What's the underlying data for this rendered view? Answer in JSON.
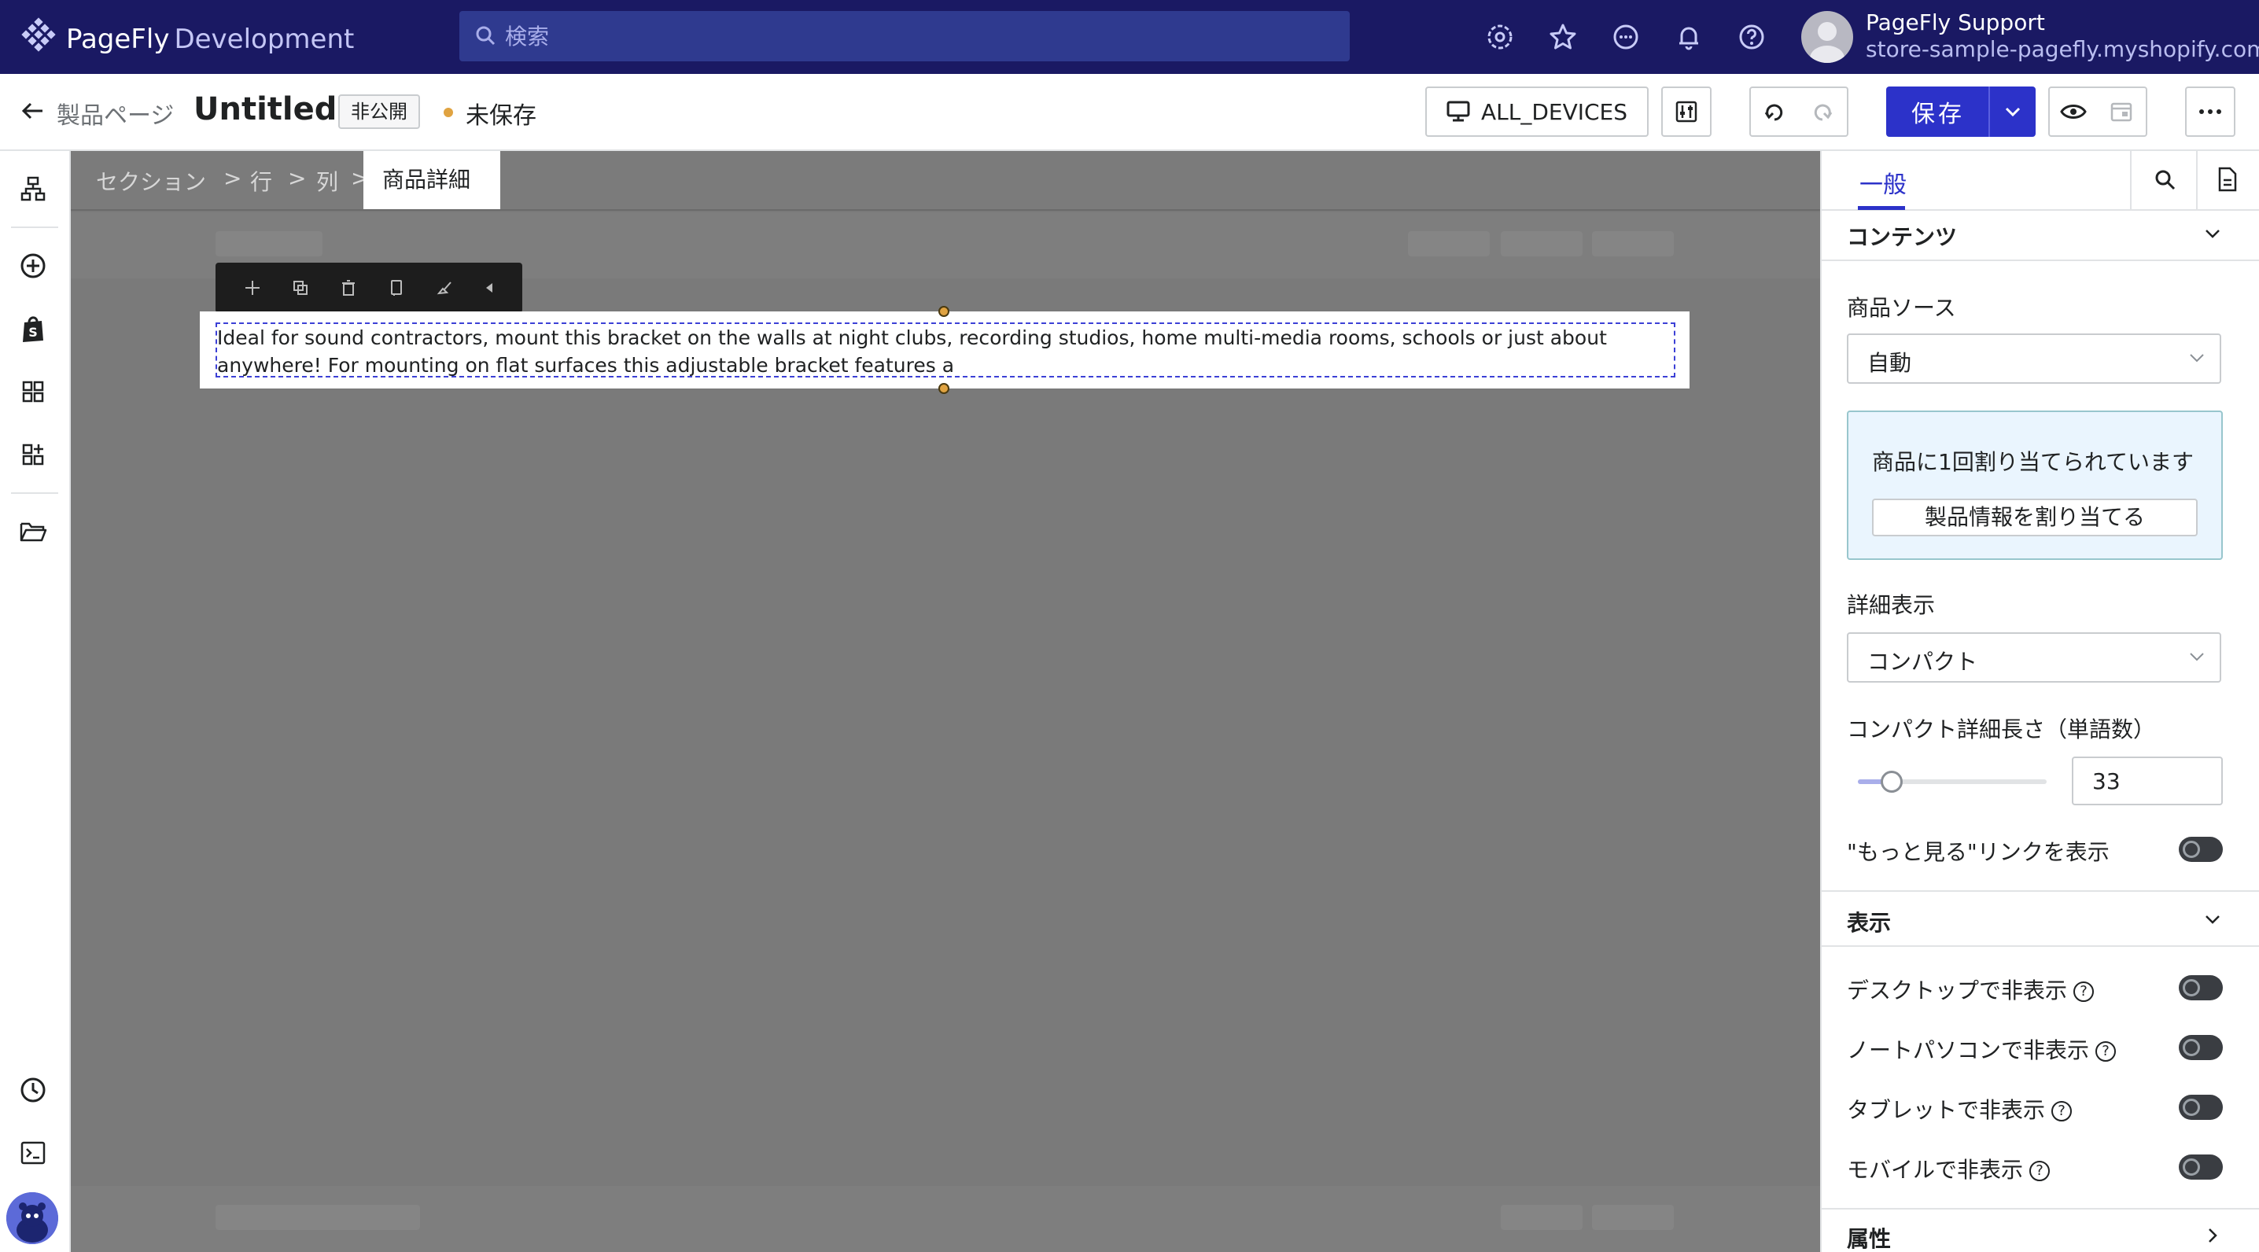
{
  "topbar": {
    "brand": "PageFly",
    "brand_sub": "Development",
    "search_placeholder": "検索",
    "user_name": "PageFly Support",
    "user_store": "store-sample-pagefly.myshopify.com"
  },
  "header": {
    "back_label": "製品ページ",
    "title": "Untitled",
    "status_badge": "非公開",
    "save_status": "未保存",
    "devices_label": "ALL_DEVICES",
    "save_label": "保存"
  },
  "breadcrumb": {
    "items": [
      "セクション",
      "行",
      "列"
    ],
    "active": "商品詳細"
  },
  "canvas": {
    "text": "Ideal for sound contractors, mount this bracket on the walls at night clubs, recording studios, home multi-media rooms, schools or just about anywhere! For mounting on flat surfaces this adjustable bracket features a"
  },
  "panel": {
    "tab_general": "一般",
    "contents_title": "コンテンツ",
    "product_source_label": "商品ソース",
    "product_source_value": "自動",
    "assign_text": "商品に1回割り当てられています",
    "assign_button": "製品情報を割り当てる",
    "detail_label": "詳細表示",
    "detail_value": "コンパクト",
    "compact_length_label": "コンパクト詳細長さ（単語数）",
    "compact_length_value": "33",
    "slider_fraction": 0.18,
    "show_more_label": "\"もっと見る\"リンクを表示",
    "display_title": "表示",
    "hide_desktop": "デスクトップで非表示",
    "hide_laptop": "ノートパソコンで非表示",
    "hide_tablet": "タブレットで非表示",
    "hide_mobile": "モバイルで非表示",
    "attributes_title": "属性"
  }
}
